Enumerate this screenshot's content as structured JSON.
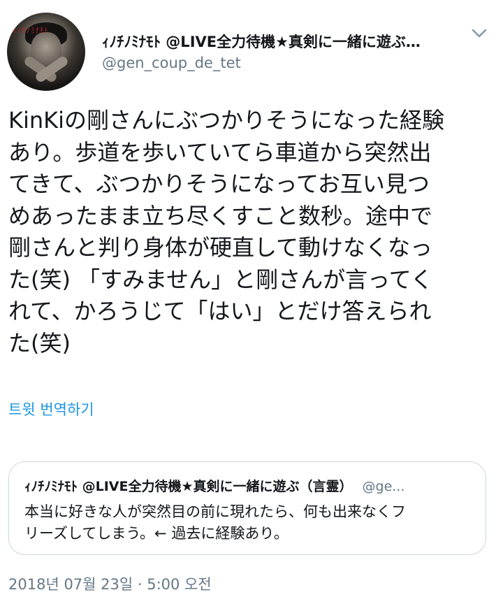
{
  "tweet": {
    "author": {
      "display_name": "ｨﾉﾁﾉﾐﾅﾓﾄ @LIVE全力待機★真剣に一緒に遊ぶ…",
      "handle": "@gen_coup_de_tet",
      "avatar_text": "ｨﾉﾁﾉﾐﾅﾓﾄ"
    },
    "menu_icon": "chevron-down-icon",
    "text_lines": [
      "KinKiの剛さんにぶつかりそうになった経験",
      "あり。歩道を歩いていてら車道から突然出",
      "てきて、ぶつかりそうになってお互い見つ",
      "めあったまま立ち尽くすこと数秒。途中で",
      "剛さんと判り身体が硬直して動けなくなっ",
      "た(笑) 「すみません」と剛さんが言ってく",
      "れて、かろうじて「はい」とだけ答えられ",
      "た(笑)"
    ],
    "translate_label": "트윗 번역하기",
    "quoted": {
      "display_name": "ｨﾉﾁﾉﾐﾅﾓﾄ @LIVE全力待機★真剣に一緒に遊ぶ（言霊）",
      "handle": "@ge...",
      "text_lines": [
        "本当に好きな人が突然目の前に現れたら、何も出来なくフ",
        "リーズしてしまう。← 過去に経験あり。"
      ]
    },
    "timestamp": "2018년 07월 23일 · 5:00 오전"
  },
  "colors": {
    "link": "#1b95e0",
    "secondary_text": "#657786",
    "border": "#ccd6dd"
  }
}
